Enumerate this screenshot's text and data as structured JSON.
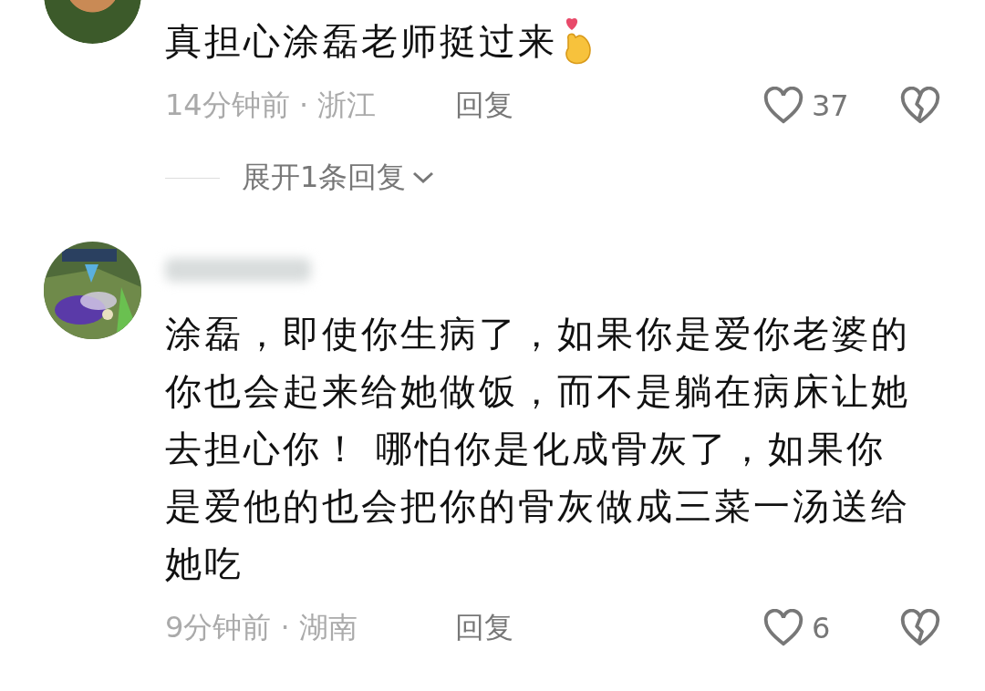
{
  "comments": [
    {
      "avatar": {
        "kind": "plain"
      },
      "name_blurred": false,
      "text": "真担心涂磊老师挺过来",
      "finger_heart": true,
      "meta": "14分钟前 · 浙江",
      "reply": "回复",
      "likes": "37",
      "expand": "展开1条回复"
    },
    {
      "name_blurred": true,
      "text": "涂磊，即使你生病了，如果你是爱你老婆的你也会起来给她做饭，而不是躺在病床让她去担心你！ 哪怕你是化成骨灰了，如果你是爱他的也会把你的骨灰做成三菜一汤送给她吃",
      "meta": "9分钟前 · 湖南",
      "reply": "回复",
      "likes": "6"
    }
  ]
}
